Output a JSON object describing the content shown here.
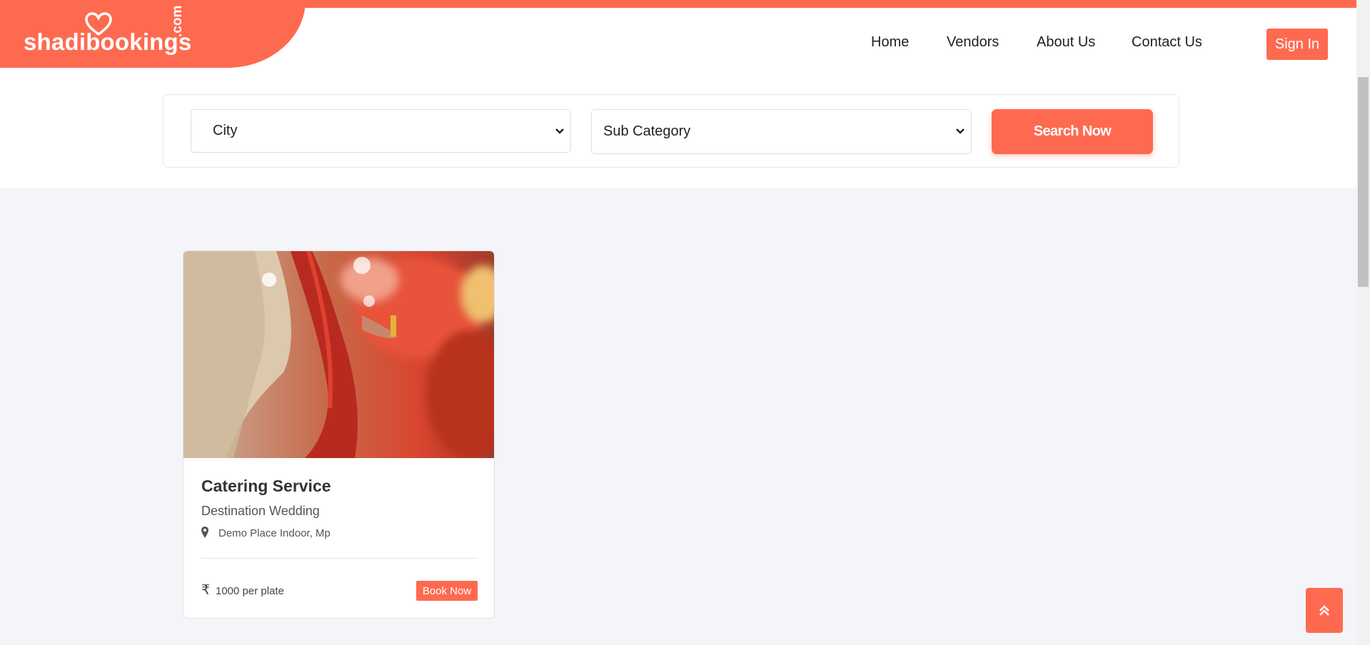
{
  "brand": {
    "logo_text": "shadibookings",
    "logo_suffix": ".com",
    "accent_color": "#fe6a50"
  },
  "nav": {
    "items": [
      "Home",
      "Vendors",
      "About Us",
      "Contact Us"
    ],
    "sign_in": "Sign In"
  },
  "search": {
    "city_value": "City",
    "subcategory_value": "Sub Category",
    "button_label": "Search Now"
  },
  "listing": {
    "title": "Catering Service",
    "category": "Destination Wedding",
    "location": "Demo Place Indoor, Mp",
    "price_symbol": "₹",
    "price": "1000 per plate",
    "book_label": "Book Now"
  },
  "icons": {
    "location": "map-pin-icon",
    "scroll_top": "double-chevron-up-icon",
    "dropdown": "chevron-down-icon"
  }
}
